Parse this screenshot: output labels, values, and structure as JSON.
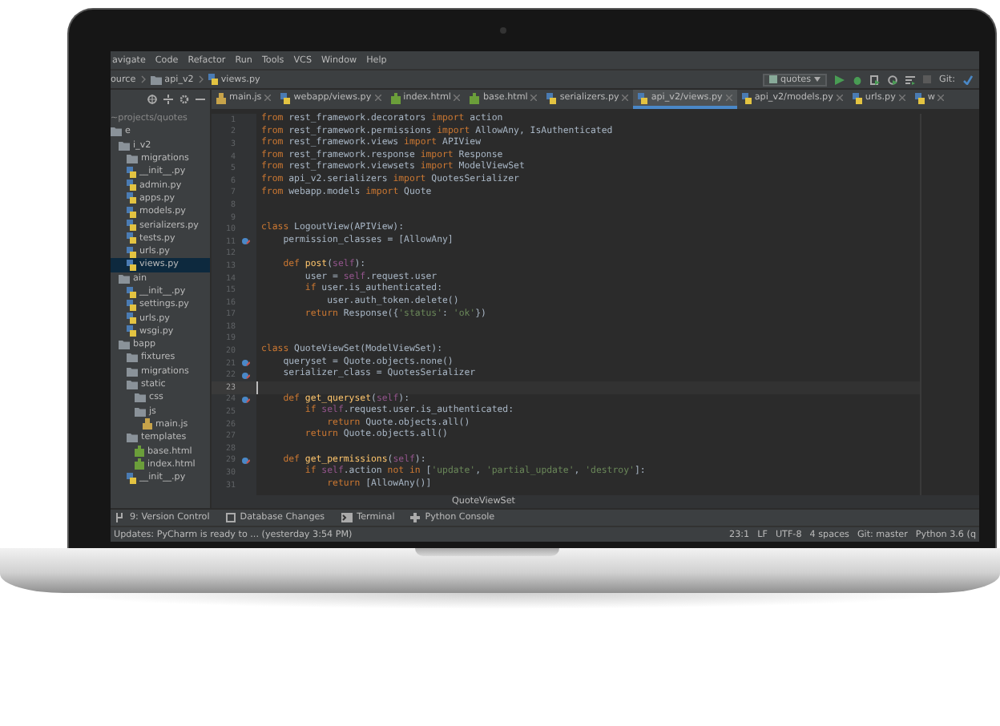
{
  "menu": [
    "avigate",
    "Code",
    "Refactor",
    "Run",
    "Tools",
    "VCS",
    "Window",
    "Help"
  ],
  "breadcrumb": [
    "ource",
    "api_v2",
    "views.py"
  ],
  "toolbar": {
    "run_config": "quotes",
    "git_label": "Git:"
  },
  "sidebar": {
    "header": "~projects/quotes",
    "tree": [
      {
        "label": "e",
        "kind": "folder",
        "selected": false,
        "children": [
          {
            "label": "i_v2",
            "kind": "folder",
            "selected": false,
            "children": [
              {
                "label": "migrations",
                "kind": "folder",
                "selected": false
              },
              {
                "label": "__init__.py",
                "kind": "py",
                "selected": false
              },
              {
                "label": "admin.py",
                "kind": "py",
                "selected": false
              },
              {
                "label": "apps.py",
                "kind": "py",
                "selected": false
              },
              {
                "label": "models.py",
                "kind": "py",
                "selected": false
              },
              {
                "label": "serializers.py",
                "kind": "py",
                "selected": false
              },
              {
                "label": "tests.py",
                "kind": "py",
                "selected": false
              },
              {
                "label": "urls.py",
                "kind": "py",
                "selected": false
              },
              {
                "label": "views.py",
                "kind": "py",
                "selected": true
              }
            ]
          },
          {
            "label": "ain",
            "kind": "folder",
            "selected": false,
            "children": [
              {
                "label": "__init__.py",
                "kind": "py",
                "selected": false
              },
              {
                "label": "settings.py",
                "kind": "py",
                "selected": false
              },
              {
                "label": "urls.py",
                "kind": "py",
                "selected": false
              },
              {
                "label": "wsgi.py",
                "kind": "py",
                "selected": false
              }
            ]
          },
          {
            "label": "bapp",
            "kind": "folder",
            "selected": false,
            "children": [
              {
                "label": "fixtures",
                "kind": "folder",
                "selected": false
              },
              {
                "label": "migrations",
                "kind": "folder",
                "selected": false
              },
              {
                "label": "static",
                "kind": "folder",
                "selected": false,
                "children": [
                  {
                    "label": "css",
                    "kind": "folder",
                    "selected": false
                  },
                  {
                    "label": "js",
                    "kind": "folder",
                    "selected": false,
                    "children": [
                      {
                        "label": "main.js",
                        "kind": "js",
                        "selected": false
                      }
                    ]
                  }
                ]
              },
              {
                "label": "templates",
                "kind": "folder",
                "selected": false,
                "children": [
                  {
                    "label": "base.html",
                    "kind": "html",
                    "selected": false
                  },
                  {
                    "label": "index.html",
                    "kind": "html",
                    "selected": false
                  }
                ]
              },
              {
                "label": "__init__.py",
                "kind": "py",
                "selected": false
              }
            ]
          }
        ]
      }
    ]
  },
  "tabs": [
    {
      "label": "main.js",
      "kind": "js",
      "selected": false
    },
    {
      "label": "webapp/views.py",
      "kind": "py",
      "selected": false
    },
    {
      "label": "index.html",
      "kind": "html",
      "selected": false
    },
    {
      "label": "base.html",
      "kind": "html",
      "selected": false
    },
    {
      "label": "serializers.py",
      "kind": "py",
      "selected": false
    },
    {
      "label": "api_v2/views.py",
      "kind": "py",
      "selected": true
    },
    {
      "label": "api_v2/models.py",
      "kind": "py",
      "selected": false
    },
    {
      "label": "urls.py",
      "kind": "py",
      "selected": false
    },
    {
      "label": "w",
      "kind": "py",
      "selected": false
    }
  ],
  "editor": {
    "lines": [
      {
        "number": "1",
        "marker": false,
        "current": false,
        "tokens": [
          {
            "kind": "kw",
            "text": "from"
          },
          {
            "kind": "plain",
            "text": " rest_framework.decorators "
          },
          {
            "kind": "kw",
            "text": "import"
          },
          {
            "kind": "plain",
            "text": " action"
          }
        ]
      },
      {
        "number": "2",
        "marker": false,
        "current": false,
        "tokens": [
          {
            "kind": "kw",
            "text": "from"
          },
          {
            "kind": "plain",
            "text": " rest_framework.permissions "
          },
          {
            "kind": "kw",
            "text": "import"
          },
          {
            "kind": "plain",
            "text": " AllowAny, IsAuthenticated"
          }
        ]
      },
      {
        "number": "3",
        "marker": false,
        "current": false,
        "tokens": [
          {
            "kind": "kw",
            "text": "from"
          },
          {
            "kind": "plain",
            "text": " rest_framework.views "
          },
          {
            "kind": "kw",
            "text": "import"
          },
          {
            "kind": "plain",
            "text": " APIView"
          }
        ]
      },
      {
        "number": "4",
        "marker": false,
        "current": false,
        "tokens": [
          {
            "kind": "kw",
            "text": "from"
          },
          {
            "kind": "plain",
            "text": " rest_framework.response "
          },
          {
            "kind": "kw",
            "text": "import"
          },
          {
            "kind": "plain",
            "text": " Response"
          }
        ]
      },
      {
        "number": "5",
        "marker": false,
        "current": false,
        "tokens": [
          {
            "kind": "kw",
            "text": "from"
          },
          {
            "kind": "plain",
            "text": " rest_framework.viewsets "
          },
          {
            "kind": "kw",
            "text": "import"
          },
          {
            "kind": "plain",
            "text": " ModelViewSet"
          }
        ]
      },
      {
        "number": "6",
        "marker": false,
        "current": false,
        "tokens": [
          {
            "kind": "kw",
            "text": "from"
          },
          {
            "kind": "plain",
            "text": " api_v2.serializers "
          },
          {
            "kind": "kw",
            "text": "import"
          },
          {
            "kind": "plain",
            "text": " QuotesSerializer"
          }
        ]
      },
      {
        "number": "7",
        "marker": false,
        "current": false,
        "tokens": [
          {
            "kind": "kw",
            "text": "from"
          },
          {
            "kind": "plain",
            "text": " webapp.models "
          },
          {
            "kind": "kw",
            "text": "import"
          },
          {
            "kind": "plain",
            "text": " Quote"
          }
        ]
      },
      {
        "number": "8",
        "marker": false,
        "current": false
      },
      {
        "number": "9",
        "marker": false,
        "current": false
      },
      {
        "number": "10",
        "marker": false,
        "current": false,
        "tokens": [
          {
            "kind": "kw",
            "text": "class"
          },
          {
            "kind": "plain",
            "text": " LogoutView(APIView):"
          }
        ]
      },
      {
        "number": "11",
        "marker": true,
        "current": false,
        "tokens": [
          {
            "kind": "plain",
            "text": "    permission_classes = [AllowAny]"
          }
        ]
      },
      {
        "number": "12",
        "marker": false,
        "current": false
      },
      {
        "number": "13",
        "marker": false,
        "current": false,
        "tokens": [
          {
            "kind": "kw",
            "text": "    def"
          },
          {
            "kind": "fn",
            "text": " post"
          },
          {
            "kind": "plain",
            "text": "("
          },
          {
            "kind": "self",
            "text": "self"
          },
          {
            "kind": "plain",
            "text": "):"
          }
        ]
      },
      {
        "number": "14",
        "marker": false,
        "current": false,
        "tokens": [
          {
            "kind": "plain",
            "text": "        user = "
          },
          {
            "kind": "self",
            "text": "self"
          },
          {
            "kind": "plain",
            "text": ".request.user"
          }
        ]
      },
      {
        "number": "15",
        "marker": false,
        "current": false,
        "tokens": [
          {
            "kind": "kw",
            "text": "        if"
          },
          {
            "kind": "plain",
            "text": " user.is_authenticated:"
          }
        ]
      },
      {
        "number": "16",
        "marker": false,
        "current": false,
        "tokens": [
          {
            "kind": "plain",
            "text": "            user.auth_token.delete()"
          }
        ]
      },
      {
        "number": "17",
        "marker": false,
        "current": false,
        "tokens": [
          {
            "kind": "kw",
            "text": "        return"
          },
          {
            "kind": "plain",
            "text": " Response({"
          },
          {
            "kind": "str",
            "text": "'status'"
          },
          {
            "kind": "plain",
            "text": ": "
          },
          {
            "kind": "str",
            "text": "'ok'"
          },
          {
            "kind": "plain",
            "text": "})"
          }
        ]
      },
      {
        "number": "18",
        "marker": false,
        "current": false
      },
      {
        "number": "19",
        "marker": false,
        "current": false
      },
      {
        "number": "20",
        "marker": false,
        "current": false,
        "tokens": [
          {
            "kind": "kw",
            "text": "class"
          },
          {
            "kind": "plain",
            "text": " QuoteViewSet(ModelViewSet):"
          }
        ]
      },
      {
        "number": "21",
        "marker": true,
        "current": false,
        "tokens": [
          {
            "kind": "plain",
            "text": "    queryset = Quote.objects.none()"
          }
        ]
      },
      {
        "number": "22",
        "marker": true,
        "current": false,
        "tokens": [
          {
            "kind": "plain",
            "text": "    serializer_class = QuotesSerializer"
          }
        ]
      },
      {
        "number": "23",
        "marker": false,
        "current": true
      },
      {
        "number": "24",
        "marker": true,
        "current": false,
        "tokens": [
          {
            "kind": "kw",
            "text": "    def"
          },
          {
            "kind": "fn",
            "text": " get_queryset"
          },
          {
            "kind": "plain",
            "text": "("
          },
          {
            "kind": "self",
            "text": "self"
          },
          {
            "kind": "plain",
            "text": "):"
          }
        ]
      },
      {
        "number": "25",
        "marker": false,
        "current": false,
        "tokens": [
          {
            "kind": "kw",
            "text": "        if"
          },
          {
            "kind": "self",
            "text": " self"
          },
          {
            "kind": "plain",
            "text": ".request.user.is_authenticated:"
          }
        ]
      },
      {
        "number": "26",
        "marker": false,
        "current": false,
        "tokens": [
          {
            "kind": "kw",
            "text": "            return"
          },
          {
            "kind": "plain",
            "text": " Quote.objects.all()"
          }
        ]
      },
      {
        "number": "27",
        "marker": false,
        "current": false,
        "tokens": [
          {
            "kind": "kw",
            "text": "        return"
          },
          {
            "kind": "plain",
            "text": " Quote.objects.all()"
          }
        ]
      },
      {
        "number": "28",
        "marker": false,
        "current": false
      },
      {
        "number": "29",
        "marker": true,
        "current": false,
        "tokens": [
          {
            "kind": "kw",
            "text": "    def"
          },
          {
            "kind": "fn",
            "text": " get_permissions"
          },
          {
            "kind": "plain",
            "text": "("
          },
          {
            "kind": "self",
            "text": "self"
          },
          {
            "kind": "plain",
            "text": "):"
          }
        ]
      },
      {
        "number": "30",
        "marker": false,
        "current": false,
        "tokens": [
          {
            "kind": "kw",
            "text": "        if"
          },
          {
            "kind": "self",
            "text": " self"
          },
          {
            "kind": "plain",
            "text": ".action "
          },
          {
            "kind": "kw",
            "text": "not in"
          },
          {
            "kind": "plain",
            "text": " ["
          },
          {
            "kind": "str",
            "text": "'update'"
          },
          {
            "kind": "plain",
            "text": ", "
          },
          {
            "kind": "str",
            "text": "'partial_update'"
          },
          {
            "kind": "plain",
            "text": ", "
          },
          {
            "kind": "str",
            "text": "'destroy'"
          },
          {
            "kind": "plain",
            "text": "]:"
          }
        ]
      },
      {
        "number": "31",
        "marker": false,
        "current": false,
        "tokens": [
          {
            "kind": "kw",
            "text": "            return"
          },
          {
            "kind": "plain",
            "text": " [AllowAny()]"
          }
        ]
      }
    ],
    "structure_path": "QuoteViewSet"
  },
  "tool_windows": [
    {
      "label": "9: Version Control",
      "kind": "vcs"
    },
    {
      "label": "Database Changes",
      "kind": "db"
    },
    {
      "label": "Terminal",
      "kind": "terminal"
    },
    {
      "label": "Python Console",
      "kind": "console"
    }
  ],
  "status_bar": {
    "message": "Updates: PyCharm is ready to ... (yesterday 3:54 PM)",
    "items": [
      "23:1",
      "LF",
      "UTF-8",
      "4 spaces",
      "Git: master",
      "Python 3.6 (q"
    ]
  }
}
